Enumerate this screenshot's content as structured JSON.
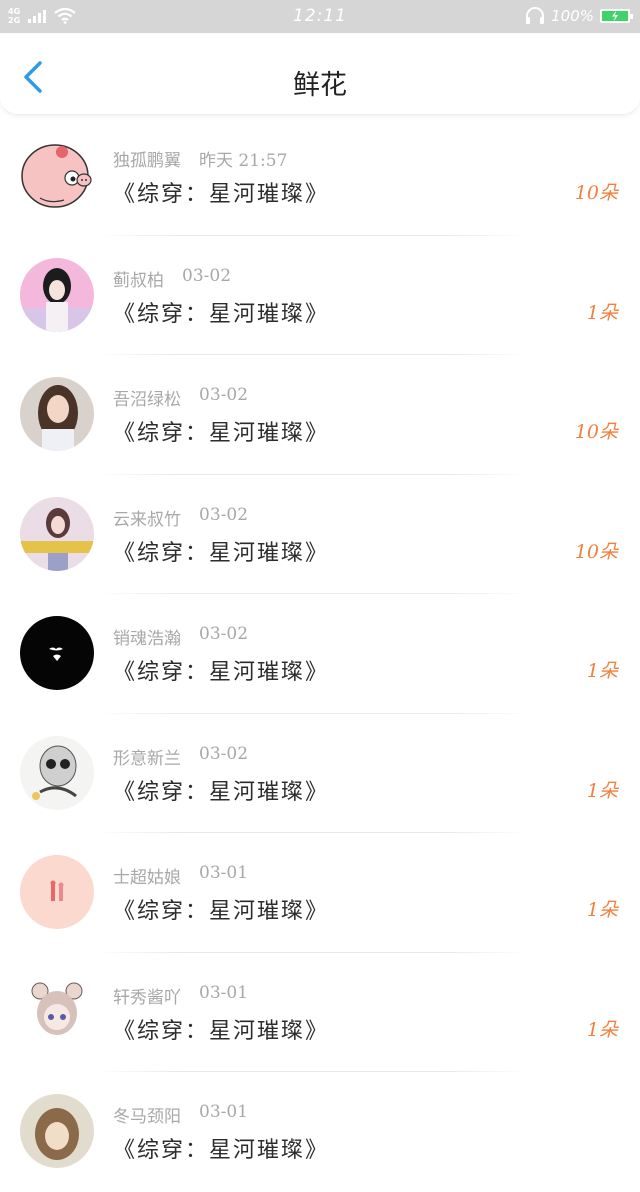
{
  "status_bar": {
    "network_top": "4G",
    "network_bottom": "2G",
    "time": "12:11",
    "battery": "100%"
  },
  "header": {
    "title": "鲜花"
  },
  "items": [
    {
      "user": "独孤鹏翼",
      "time": "昨天 21:57",
      "book": "《综穿：星河璀璨》",
      "count": "10朵"
    },
    {
      "user": "蓟叔柏",
      "time": "03-02",
      "book": "《综穿：星河璀璨》",
      "count": "1朵"
    },
    {
      "user": "吾沼绿松",
      "time": "03-02",
      "book": "《综穿：星河璀璨》",
      "count": "10朵"
    },
    {
      "user": "云来叔竹",
      "time": "03-02",
      "book": "《综穿：星河璀璨》",
      "count": "10朵"
    },
    {
      "user": "销魂浩瀚",
      "time": "03-02",
      "book": "《综穿：星河璀璨》",
      "count": "1朵"
    },
    {
      "user": "形意新兰",
      "time": "03-02",
      "book": "《综穿：星河璀璨》",
      "count": "1朵"
    },
    {
      "user": "士超姑娘",
      "time": "03-01",
      "book": "《综穿：星河璀璨》",
      "count": "1朵"
    },
    {
      "user": "轩秀酱吖",
      "time": "03-01",
      "book": "《综穿：星河璀璨》",
      "count": "1朵"
    },
    {
      "user": "冬马颈阳",
      "time": "03-01",
      "book": "《综穿：星河璀璨》",
      "count": ""
    }
  ],
  "colors": {
    "accent_back": "#2f9be8",
    "count": "#f2803e",
    "status_bar": "#d6d6d6"
  }
}
